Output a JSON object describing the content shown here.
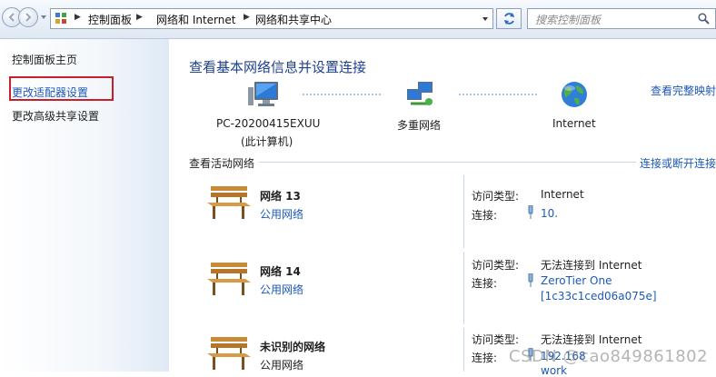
{
  "toolbar": {
    "breadcrumbs": [
      "控制面板",
      "网络和 Internet",
      "网络和共享中心"
    ],
    "search_placeholder": "搜索控制面板"
  },
  "sidebar": {
    "items": [
      {
        "label": "控制面板主页"
      },
      {
        "label": "更改适配器设置"
      },
      {
        "label": "更改高级共享设置"
      }
    ]
  },
  "main": {
    "title": "查看基本网络信息并设置连接",
    "view_full_map": "查看完整映射",
    "map": {
      "computer_name": "PC-20200415EXUU",
      "computer_sub": "(此计算机)",
      "middle": "多重网络",
      "internet": "Internet"
    },
    "active_header": "查看活动网络",
    "connect_link": "连接或断开连接",
    "networks": [
      {
        "name": "网络  13",
        "type": "公用网络",
        "access_key": "访问类型:",
        "access_val": "Internet",
        "conn_key": "连接:",
        "conn_val": "10.",
        "conn_val2": ""
      },
      {
        "name": "网络  14",
        "type": "公用网络",
        "access_key": "访问类型:",
        "access_val": "无法连接到 Internet",
        "conn_key": "连接:",
        "conn_val": "ZeroTier One",
        "conn_val2": "[1c33c1ced06a075e]"
      },
      {
        "name": "未识别的网络",
        "type": "公用网络",
        "access_key": "访问类型:",
        "access_val": "无法连接到 Internet",
        "conn_key": "连接:",
        "conn_val": "192.168",
        "conn_val2": "work"
      }
    ]
  },
  "watermark": "CSDN @cao849861802"
}
